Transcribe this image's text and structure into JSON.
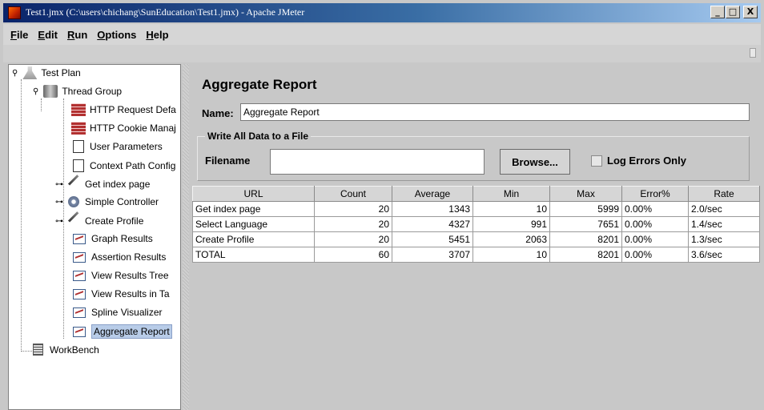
{
  "window": {
    "title": "Test1.jmx (C:\\users\\chichang\\SunEducation\\Test1.jmx) - Apache JMeter",
    "controls": {
      "minimize": "_",
      "maximize": "□",
      "close": "X"
    }
  },
  "menubar": {
    "items": [
      {
        "label": "File",
        "mnemonic": "F"
      },
      {
        "label": "Edit",
        "mnemonic": "E"
      },
      {
        "label": "Run",
        "mnemonic": "R"
      },
      {
        "label": "Options",
        "mnemonic": "O"
      },
      {
        "label": "Help",
        "mnemonic": "H"
      }
    ]
  },
  "tree": {
    "nodes": [
      {
        "label": "Test Plan",
        "icon": "flask-icon"
      },
      {
        "label": "Thread Group",
        "icon": "spool-icon"
      },
      {
        "label": "HTTP Request Defa",
        "icon": "bricks-icon"
      },
      {
        "label": "HTTP Cookie Manaj",
        "icon": "bricks-icon"
      },
      {
        "label": "User Parameters",
        "icon": "page-icon"
      },
      {
        "label": "Context Path Config",
        "icon": "page-icon"
      },
      {
        "label": "Get index page",
        "icon": "pen-icon"
      },
      {
        "label": "Simple Controller",
        "icon": "gear-icon"
      },
      {
        "label": "Create Profile",
        "icon": "pen-icon"
      },
      {
        "label": "Graph Results",
        "icon": "graph-icon"
      },
      {
        "label": "Assertion Results",
        "icon": "graph-icon"
      },
      {
        "label": "View Results Tree",
        "icon": "graph-icon"
      },
      {
        "label": "View Results in Ta",
        "icon": "graph-icon"
      },
      {
        "label": "Spline Visualizer",
        "icon": "graph-icon"
      },
      {
        "label": "Aggregate Report",
        "icon": "graph-icon",
        "selected": true
      },
      {
        "label": "WorkBench",
        "icon": "workbench-icon"
      }
    ]
  },
  "report": {
    "title": "Aggregate Report",
    "name_label": "Name:",
    "name_value": "Aggregate Report",
    "file_group_label": "Write All Data to a File",
    "filename_label": "Filename",
    "filename_value": "",
    "browse_label": "Browse...",
    "log_errors_label": "Log Errors Only",
    "log_errors_checked": false
  },
  "table": {
    "columns": [
      "URL",
      "Count",
      "Average",
      "Min",
      "Max",
      "Error%",
      "Rate"
    ],
    "rows": [
      [
        "Get index page",
        "20",
        "1343",
        "10",
        "5999",
        "0.00%",
        "2.0/sec"
      ],
      [
        "Select Language",
        "20",
        "4327",
        "991",
        "7651",
        "0.00%",
        "1.4/sec"
      ],
      [
        "Create Profile",
        "20",
        "5451",
        "2063",
        "8201",
        "0.00%",
        "1.3/sec"
      ],
      [
        "TOTAL",
        "60",
        "3707",
        "10",
        "8201",
        "0.00%",
        "3.6/sec"
      ]
    ]
  }
}
